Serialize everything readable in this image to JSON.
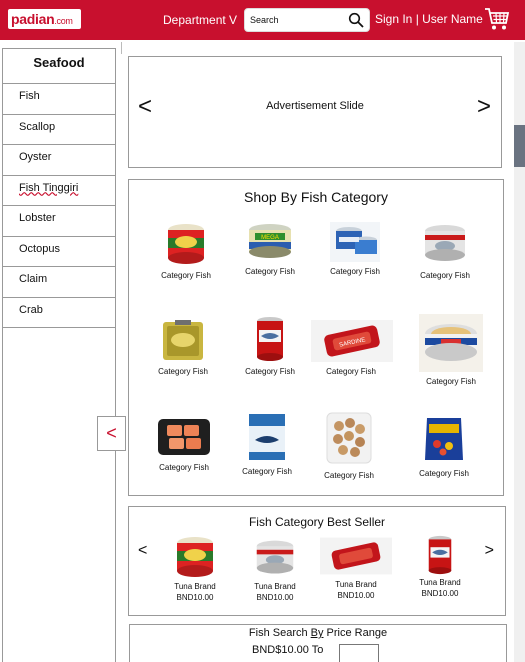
{
  "header": {
    "logo_text": "padian",
    "logo_suffix": ".com",
    "department": "Department V",
    "search_placeholder": "Search",
    "signin": "Sign In | User Name",
    "bg_color": "#c8102e"
  },
  "sidebar": {
    "title": "Seafood",
    "items": [
      {
        "label": "Fish"
      },
      {
        "label": "Scallop"
      },
      {
        "label": "Oyster"
      },
      {
        "label": "Fish Tinggiri"
      },
      {
        "label": "Lobster"
      },
      {
        "label": "Octopus"
      },
      {
        "label": "Claim"
      },
      {
        "label": "Crab"
      }
    ],
    "collapse_glyph": "<"
  },
  "ad": {
    "text": "Advertisement Slide",
    "prev": "<",
    "next": ">"
  },
  "shop": {
    "title": "Shop By Fish Category",
    "categories": [
      {
        "label": "Category Fish",
        "icon": "tuna-can-red-icon"
      },
      {
        "label": "Category Fish",
        "icon": "tuna-can-mega-icon"
      },
      {
        "label": "Category Fish",
        "icon": "tuna-cans-blue-icon"
      },
      {
        "label": "Category Fish",
        "icon": "tuna-can-silver-icon"
      },
      {
        "label": "Category Fish",
        "icon": "sardine-tin-yellow-icon"
      },
      {
        "label": "Category Fish",
        "icon": "mackerel-can-red-icon"
      },
      {
        "label": "Category Fish",
        "icon": "sardine-tin-red-icon"
      },
      {
        "label": "Category Fish",
        "icon": "tuna-can-open-icon"
      },
      {
        "label": "Category Fish",
        "icon": "salmon-pack-icon"
      },
      {
        "label": "Category Fish",
        "icon": "frozen-fish-bag-icon"
      },
      {
        "label": "Category Fish",
        "icon": "fish-balls-bag-icon"
      },
      {
        "label": "Category Fish",
        "icon": "fish-snack-bag-icon"
      }
    ]
  },
  "best_seller": {
    "title": "Fish Category Best Seller",
    "prev": "<",
    "next": ">",
    "products": [
      {
        "name": "Tuna Brand",
        "price": "BND10.00",
        "icon": "tuna-can-red-icon"
      },
      {
        "name": "Tuna Brand",
        "price": "BND10.00",
        "icon": "tuna-can-silver-icon"
      },
      {
        "name": "Tuna Brand",
        "price": "BND10.00",
        "icon": "sardine-tin-red-icon"
      },
      {
        "name": "Tuna Brand",
        "price": "BND10.00",
        "icon": "mackerel-can-red-icon"
      }
    ]
  },
  "price_range": {
    "title_pre": "Fish Search ",
    "title_by": "By",
    "title_post": " Price Range",
    "from_label": "BND$10.00 To",
    "input_value": ""
  }
}
